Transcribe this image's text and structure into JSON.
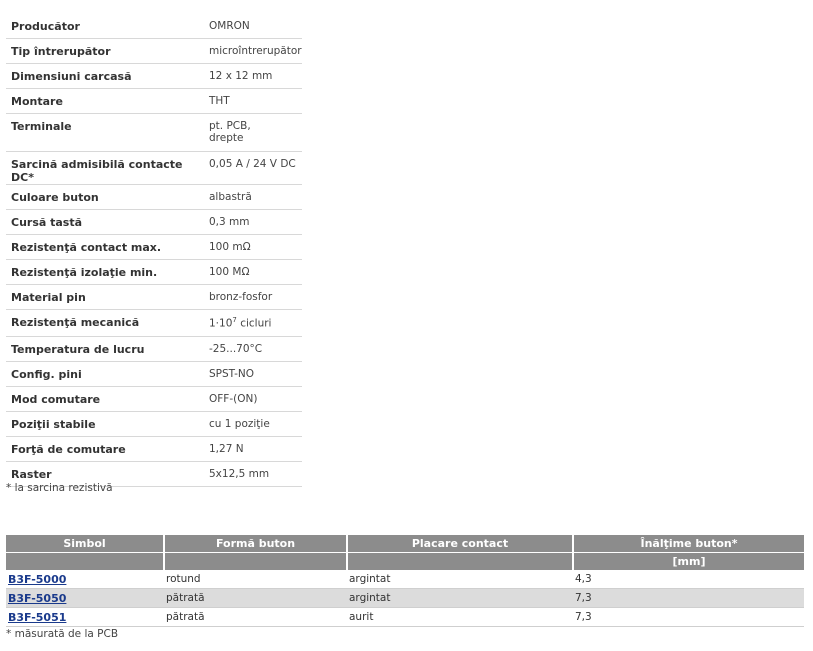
{
  "specs": [
    {
      "key": "Producător",
      "val": "OMRON"
    },
    {
      "key": "Tip întrerupător",
      "val": "microîntrerupător"
    },
    {
      "key": "Dimensiuni carcasă",
      "val": "12 x 12 mm"
    },
    {
      "key": "Montare",
      "val": "THT"
    },
    {
      "key": "Terminale",
      "val": "pt. PCB,",
      "val2": "drepte"
    },
    {
      "key": "Sarcină admisibilă contacte DC*",
      "val": "0,05 A / 24 V DC"
    },
    {
      "key": "Culoare buton",
      "val": "albastră"
    },
    {
      "key": "Cursă tastă",
      "val": "0,3 mm"
    },
    {
      "key": "Rezistenţă contact max.",
      "val": "100 mΩ"
    },
    {
      "key": "Rezistenţă izolaţie min.",
      "val": "100 MΩ"
    },
    {
      "key": "Material pin",
      "val": "bronz-fosfor"
    },
    {
      "key": "Rezistenţă mecanică",
      "val_base": "1·10",
      "val_exp": "7",
      "val_tail": " cicluri"
    },
    {
      "key": "Temperatura de lucru",
      "val": "-25...70°C"
    },
    {
      "key": "Config. pini",
      "val": "SPST-NO"
    },
    {
      "key": "Mod comutare",
      "val": "OFF-(ON)"
    },
    {
      "key": "Poziţii stabile",
      "val": "cu 1 poziţie"
    },
    {
      "key": "Forţă de comutare",
      "val": "1,27 N"
    },
    {
      "key": "Raster",
      "val": "5x12,5 mm"
    }
  ],
  "note1": "* la sarcina rezistivă",
  "products": {
    "headers": [
      "Simbol",
      "Formă buton",
      "Placare contact",
      "Înălţime buton*"
    ],
    "subheader_unit": "[mm]",
    "rows": [
      {
        "symbol": "B3F-5000",
        "shape": "rotund",
        "plating": "argintat",
        "height": "4,3"
      },
      {
        "symbol": "B3F-5050",
        "shape": "pătrată",
        "plating": "argintat",
        "height": "7,3"
      },
      {
        "symbol": "B3F-5051",
        "shape": "pătrată",
        "plating": "aurit",
        "height": "7,3"
      }
    ]
  },
  "note2": "* măsurată de la PCB"
}
